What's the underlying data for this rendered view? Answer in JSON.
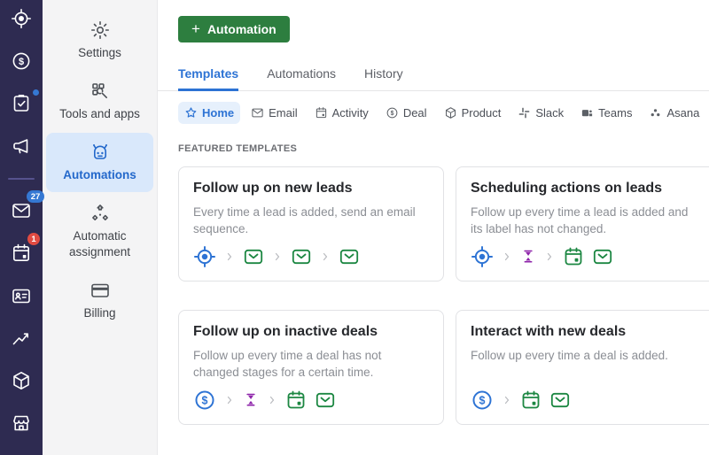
{
  "colors": {
    "rail_bg": "#2e2b51",
    "accent_blue": "#2d73d4",
    "button_green": "#2d7e3f",
    "action_green": "#1c8742",
    "delay_purple": "#8e24aa",
    "badge_blue": "#3578d3",
    "badge_red": "#e14b42",
    "active_item_bg": "#d9e8fb"
  },
  "left_nav": {
    "items": [
      {
        "icon": "leads-target-icon"
      },
      {
        "icon": "deals-dollar-icon"
      },
      {
        "icon": "tasks-checklist-icon",
        "has_notification_dot": true
      },
      {
        "icon": "campaigns-megaphone-icon"
      },
      {
        "icon": "mail-envelope-icon",
        "badge": "27"
      },
      {
        "icon": "activities-calendar-icon",
        "badge": "1"
      },
      {
        "icon": "contacts-card-icon"
      },
      {
        "icon": "insights-chart-icon"
      },
      {
        "icon": "products-box-icon"
      },
      {
        "icon": "marketplace-store-icon"
      }
    ],
    "divider_after_index": 3
  },
  "settings_nav": {
    "items": [
      {
        "label": "Settings",
        "icon": "gear-icon",
        "active": false
      },
      {
        "label": "Tools and apps",
        "icon": "tools-icon",
        "active": false
      },
      {
        "label": "Automations",
        "icon": "robot-icon",
        "active": true
      },
      {
        "label": "Automatic assignment",
        "icon": "assignment-icon",
        "active": false
      },
      {
        "label": "Billing",
        "icon": "billing-card-icon",
        "active": false
      }
    ]
  },
  "header": {
    "new_automation_button": {
      "plus": "+",
      "label": "Automation"
    }
  },
  "tabs": [
    {
      "label": "Templates",
      "active": true
    },
    {
      "label": "Automations",
      "active": false
    },
    {
      "label": "History",
      "active": false
    }
  ],
  "filters": [
    {
      "label": "Home",
      "icon": "star-icon",
      "active": true
    },
    {
      "label": "Email",
      "icon": "envelope-icon",
      "active": false
    },
    {
      "label": "Activity",
      "icon": "calendar-icon",
      "active": false
    },
    {
      "label": "Deal",
      "icon": "dollar-circle-icon",
      "active": false
    },
    {
      "label": "Product",
      "icon": "cube-icon",
      "active": false
    },
    {
      "label": "Slack",
      "icon": "slack-icon",
      "active": false
    },
    {
      "label": "Teams",
      "icon": "teams-icon",
      "active": false
    },
    {
      "label": "Asana",
      "icon": "asana-icon",
      "active": false
    }
  ],
  "section_title": "FEATURED TEMPLATES",
  "cards": [
    {
      "title": "Follow up on new leads",
      "description": "Every time a lead is added, send an email sequence.",
      "flow": [
        "lead-trigger",
        "chevron",
        "email-action",
        "chevron",
        "email-action",
        "chevron",
        "email-action"
      ]
    },
    {
      "title": "Scheduling actions on leads",
      "description": "Follow up every time a lead is added and its label has not changed.",
      "flow": [
        "lead-trigger",
        "chevron",
        "delay",
        "chevron",
        "activity-action",
        "email-action"
      ]
    },
    {
      "title": "Follow up on inactive deals",
      "description": "Follow up every time a deal has not changed stages for a certain time.",
      "flow": [
        "deal-trigger",
        "chevron",
        "delay",
        "chevron",
        "activity-action",
        "email-action"
      ]
    },
    {
      "title": "Interact with new deals",
      "description": "Follow up every time a deal is added.",
      "flow": [
        "deal-trigger",
        "chevron",
        "activity-action",
        "email-action"
      ]
    }
  ]
}
